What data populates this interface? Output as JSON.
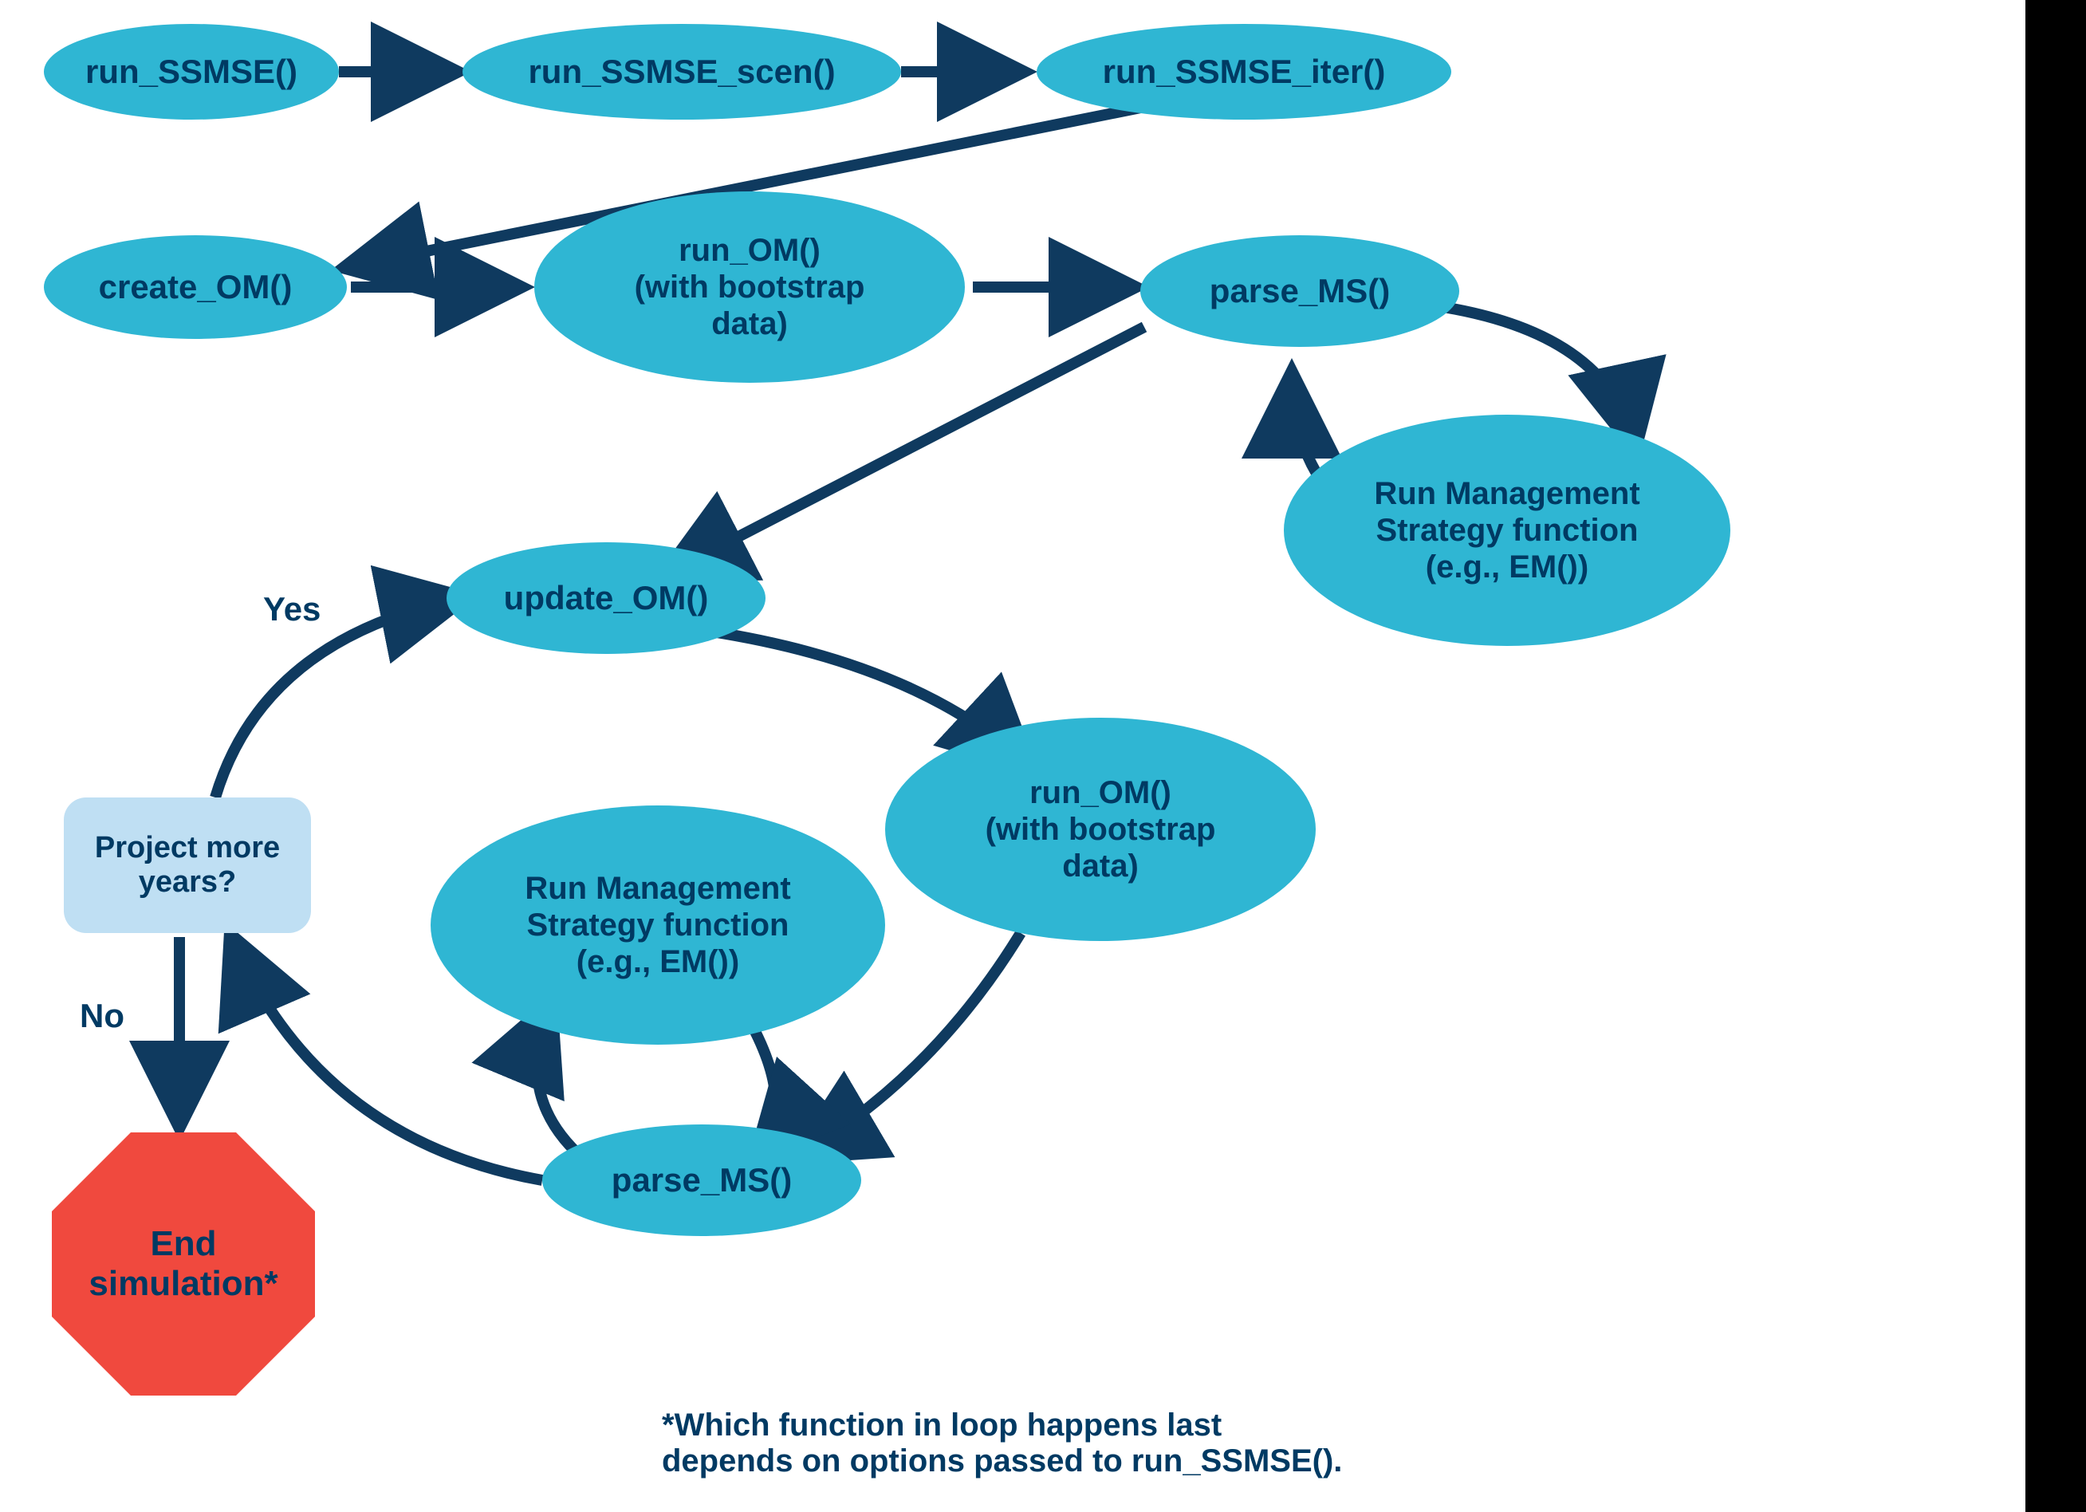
{
  "colors": {
    "nodeFill": "#2FB6D3",
    "text": "#003A63",
    "arrow": "#0F3A5F",
    "stop": "#F0493E",
    "decision": "#BFDFF3"
  },
  "nodes": {
    "run_ssmse": "run_SSMSE()",
    "run_ssmse_scen": "run_SSMSE_scen()",
    "run_ssmse_iter": "run_SSMSE_iter()",
    "create_om": "create_OM()",
    "run_om_1": "run_OM()\n(with bootstrap\ndata)",
    "parse_ms_1": "parse_MS()",
    "rms_1": "Run Management\nStrategy function\n(e.g., EM())",
    "update_om": "update_OM()",
    "run_om_2": "run_OM()\n(with bootstrap\ndata)",
    "rms_2": "Run Management\nStrategy function\n(e.g., EM())",
    "parse_ms_2": "parse_MS()",
    "decision": "Project more\nyears?",
    "stop": "End\nsimulation*"
  },
  "labels": {
    "yes": "Yes",
    "no": "No"
  },
  "footnote": "*Which function in loop happens last\ndepends on options passed to run_SSMSE()."
}
